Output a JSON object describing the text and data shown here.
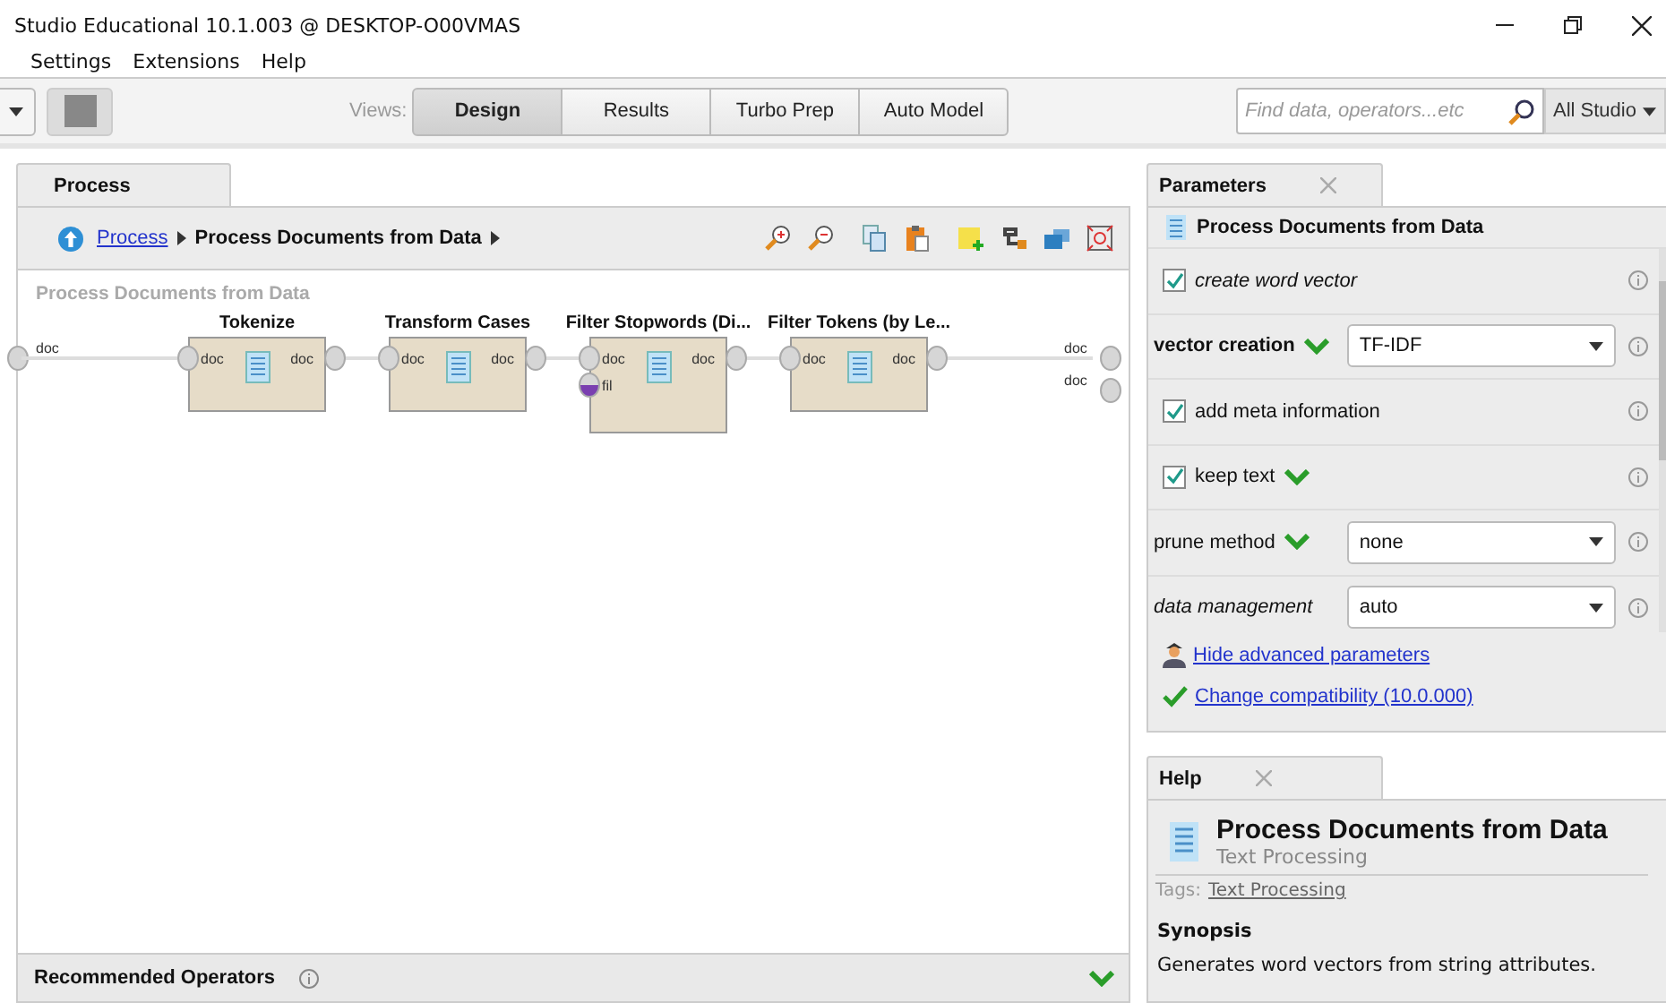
{
  "window": {
    "title": "Studio Educational 10.1.003 @ DESKTOP-O00VMAS"
  },
  "menu": [
    "Settings",
    "Extensions",
    "Help"
  ],
  "toolbar": {
    "views_label": "Views:",
    "views": [
      {
        "label": "Design",
        "selected": true
      },
      {
        "label": "Results",
        "selected": false
      },
      {
        "label": "Turbo Prep",
        "selected": false
      },
      {
        "label": "Auto Model",
        "selected": false
      }
    ],
    "search": {
      "placeholder": "Find data, operators...etc"
    },
    "scope": "All Studio"
  },
  "process": {
    "tab": "Process",
    "breadcrumb": [
      {
        "label": "Process",
        "kind": "link"
      },
      {
        "label": "Process Documents from Data",
        "kind": "current"
      }
    ],
    "canvas_title": "Process Documents from Data",
    "input_port": "doc",
    "output_ports": [
      "doc",
      "doc"
    ],
    "operators": [
      {
        "name": "Tokenize",
        "inputs": [
          "doc"
        ],
        "outputs": [
          "doc"
        ]
      },
      {
        "name": "Transform Cases",
        "inputs": [
          "doc"
        ],
        "outputs": [
          "doc"
        ]
      },
      {
        "name": "Filter Stopwords (Di...",
        "inputs": [
          "doc",
          "fil"
        ],
        "outputs": [
          "doc"
        ]
      },
      {
        "name": "Filter Tokens (by Le...",
        "inputs": [
          "doc"
        ],
        "outputs": [
          "doc"
        ]
      }
    ],
    "recommended": "Recommended Operators"
  },
  "parameters": {
    "tab": "Parameters",
    "operator": "Process Documents from Data",
    "rows": [
      {
        "kind": "checkbox",
        "label": "create word vector",
        "expert": true,
        "required": false,
        "checked": true,
        "changed": false
      },
      {
        "kind": "select",
        "label": "vector creation",
        "expert": false,
        "required": true,
        "value": "TF-IDF",
        "changed": true
      },
      {
        "kind": "checkbox",
        "label": "add meta information",
        "expert": false,
        "required": false,
        "checked": true,
        "changed": false
      },
      {
        "kind": "checkbox",
        "label": "keep text",
        "expert": false,
        "required": false,
        "checked": true,
        "changed": true
      },
      {
        "kind": "select",
        "label": "prune method",
        "expert": false,
        "required": false,
        "value": "none",
        "changed": true
      },
      {
        "kind": "select",
        "label": "data management",
        "expert": true,
        "required": false,
        "value": "auto",
        "changed": false
      }
    ],
    "links": [
      {
        "kind": "advanced",
        "label": "Hide advanced parameters"
      },
      {
        "kind": "compat",
        "label": "Change compatibility (10.0.000)"
      }
    ]
  },
  "help": {
    "tab": "Help",
    "title": "Process Documents from Data",
    "subtitle": "Text Processing",
    "tags_label": "Tags:",
    "tags": [
      "Text Processing"
    ],
    "section": "Synopsis",
    "synopsis": "Generates word vectors from string attributes."
  }
}
